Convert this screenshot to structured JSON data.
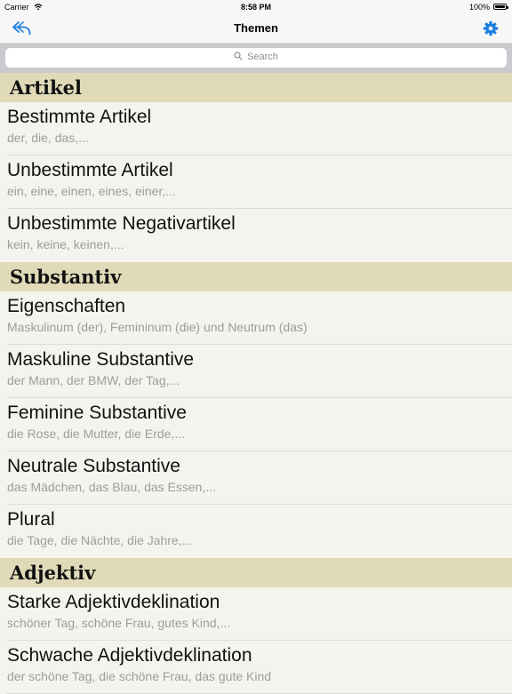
{
  "status": {
    "carrier": "Carrier",
    "time": "8:58 PM",
    "battery": "100%"
  },
  "nav": {
    "title": "Themen"
  },
  "search": {
    "placeholder": "Search"
  },
  "sections": [
    {
      "title": "Artikel",
      "rows": [
        {
          "title": "Bestimmte Artikel",
          "subtitle": "der, die, das,..."
        },
        {
          "title": "Unbestimmte Artikel",
          "subtitle": "ein, eine, einen, eines, einer,..."
        },
        {
          "title": "Unbestimmte Negativartikel",
          "subtitle": "kein, keine, keinen,..."
        }
      ]
    },
    {
      "title": "Substantiv",
      "rows": [
        {
          "title": "Eigenschaften",
          "subtitle": "Maskulinum (der), Femininum (die) und Neutrum (das)"
        },
        {
          "title": "Maskuline Substantive",
          "subtitle": "der Mann, der BMW, der Tag,..."
        },
        {
          "title": "Feminine Substantive",
          "subtitle": "die Rose, die Mutter, die Erde,..."
        },
        {
          "title": "Neutrale Substantive",
          "subtitle": "das Mädchen, das Blau, das Essen,..."
        },
        {
          "title": "Plural",
          "subtitle": "die Tage, die Nächte, die Jahre,..."
        }
      ]
    },
    {
      "title": "Adjektiv",
      "rows": [
        {
          "title": "Starke Adjektivdeklination",
          "subtitle": "schöner Tag, schöne Frau, gutes Kind,..."
        },
        {
          "title": "Schwache Adjektivdeklination",
          "subtitle": "der schöne Tag, die schöne Frau, das gute Kind"
        }
      ]
    }
  ],
  "colors": {
    "accent": "#1a7fe0",
    "section_header": "#e0dab8",
    "background": "#f5f3ee"
  },
  "icons": {
    "back": "reply-arrow-icon",
    "settings": "gear-icon",
    "search": "search-icon"
  }
}
